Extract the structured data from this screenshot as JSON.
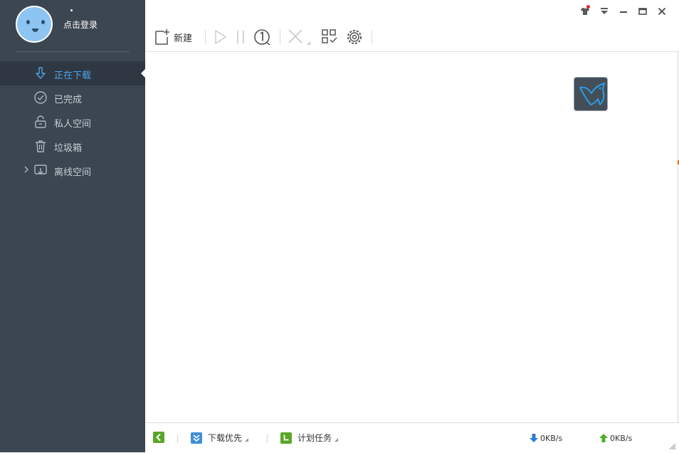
{
  "sidebar": {
    "login_text": "点击登录",
    "items": [
      {
        "label": "正在下载",
        "icon": "download-arrow-icon",
        "active": true
      },
      {
        "label": "已完成",
        "icon": "check-circle-icon",
        "active": false
      },
      {
        "label": "私人空间",
        "icon": "unlock-icon",
        "active": false
      },
      {
        "label": "垃圾箱",
        "icon": "trash-icon",
        "active": false
      },
      {
        "label": "离线空间",
        "icon": "cloud-download-icon",
        "active": false
      }
    ]
  },
  "toolbar": {
    "new_label": "新建"
  },
  "statusbar": {
    "priority_label": "下载优先",
    "schedule_label": "计划任务",
    "download_speed": "0KB/s",
    "upload_speed": "0KB/s"
  },
  "colors": {
    "sidebar_bg": "#3b4651",
    "active_item_bg": "#2f3842",
    "accent_blue": "#4fa2ea",
    "green": "#5aa628",
    "notify_red": "#e02828"
  }
}
